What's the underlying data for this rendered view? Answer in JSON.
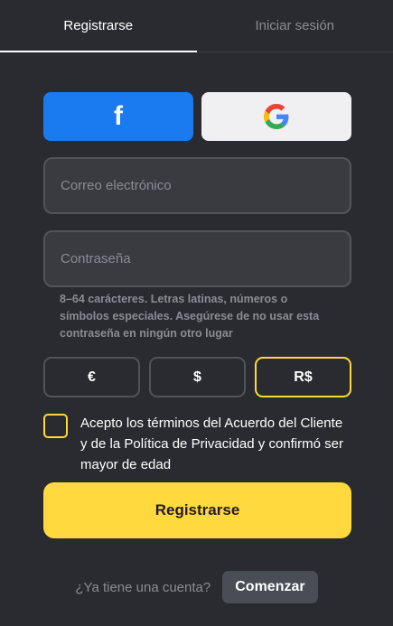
{
  "tabs": {
    "register": "Registrarse",
    "login": "Iniciar sesión"
  },
  "social": {
    "facebook_icon": "f",
    "google_icon": "google-g-logo"
  },
  "form": {
    "email_placeholder": "Correo electrónico",
    "password_placeholder": "Contraseña",
    "password_hint": "8–64 carácteres. Letras latinas, números o símbolos especiales. Asegúrese de no usar esta contraseña en ningún otro lugar"
  },
  "currencies": {
    "options": [
      "€",
      "$",
      "R$"
    ],
    "selected": "R$"
  },
  "terms": {
    "text": "Acepto los términos del Acuerdo del Cliente y de la Política de Privacidad y confirmó ser mayor de edad"
  },
  "submit_label": "Registrarse",
  "footer": {
    "question": "¿Ya tiene una cuenta?",
    "action": "Comenzar"
  },
  "colors": {
    "background": "#2a2b30",
    "accent": "#ffd83b",
    "facebook": "#1a7af0"
  }
}
